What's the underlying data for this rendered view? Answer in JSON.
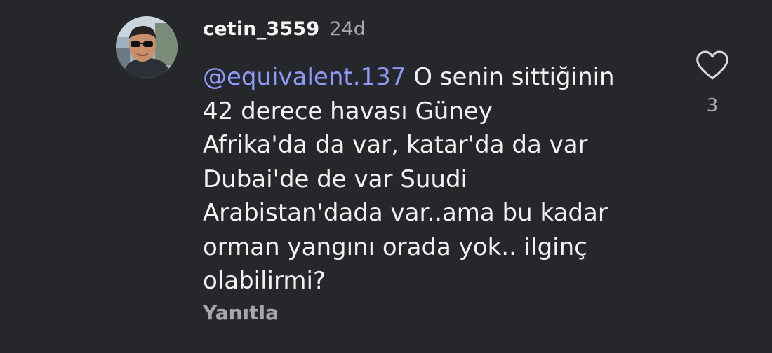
{
  "comment": {
    "username": "cetin_3559",
    "timestamp": "24d",
    "mention": "@equivalent.137",
    "text_lines": [
      " O senin sittiğinin",
      "42 derece havası Güney",
      "Afrika'da da var, katar'da da var",
      "Dubai'de de var Suudi",
      "Arabistan'dada var..ama bu kadar",
      "orman yangını orada yok.. ilginç",
      "olabilirmi?"
    ],
    "reply_label": "Yanıtla",
    "like_count": "3",
    "like_icon": "heart-outline-icon",
    "mention_color": "#8e9bff"
  }
}
